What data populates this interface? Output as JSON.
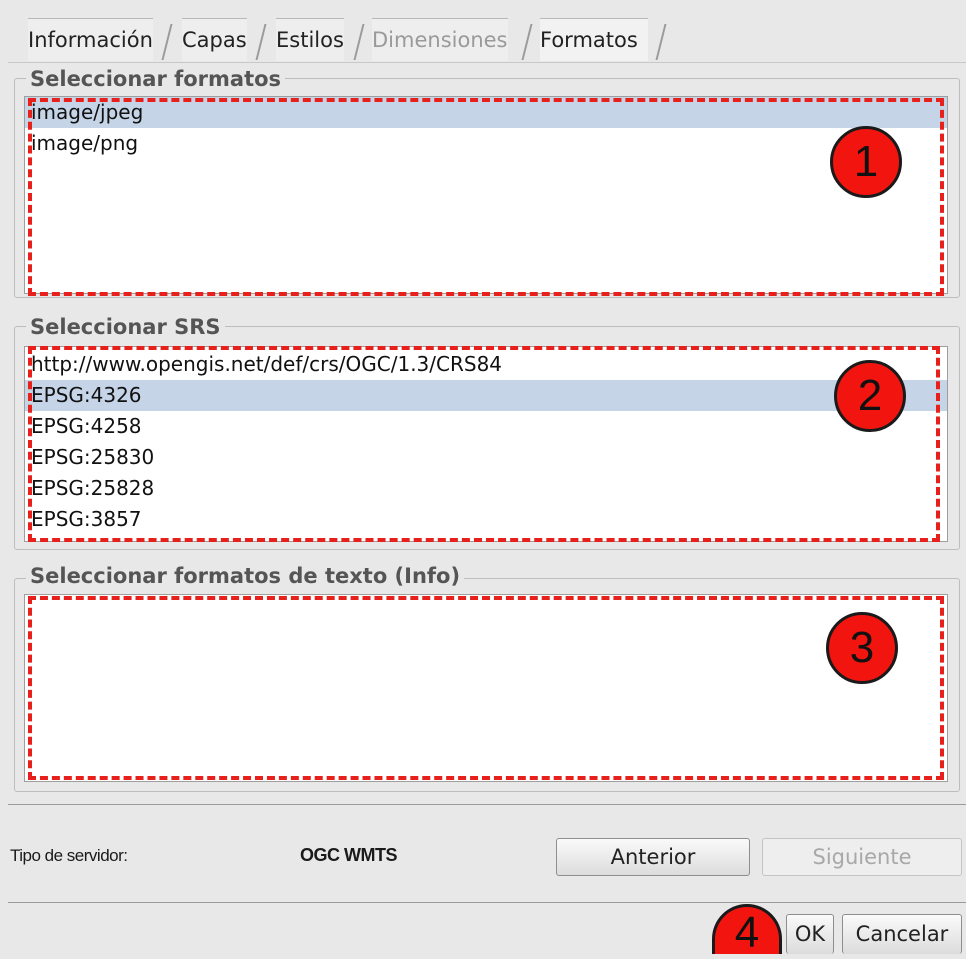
{
  "tabs": [
    {
      "label": "Información",
      "state": "normal"
    },
    {
      "label": "Capas",
      "state": "normal"
    },
    {
      "label": "Estilos",
      "state": "normal"
    },
    {
      "label": "Dimensiones",
      "state": "disabled"
    },
    {
      "label": "Formatos",
      "state": "active"
    }
  ],
  "formats_group": {
    "title": "Seleccionar formatos",
    "items": [
      "image/jpeg",
      "image/png"
    ],
    "selected": "image/jpeg"
  },
  "srs_group": {
    "title": "Seleccionar SRS",
    "items": [
      "http://www.opengis.net/def/crs/OGC/1.3/CRS84",
      "EPSG:4326",
      "EPSG:4258",
      "EPSG:25830",
      "EPSG:25828",
      "EPSG:3857"
    ],
    "selected": "EPSG:4326"
  },
  "info_formats_group": {
    "title": "Seleccionar formatos de texto (Info)",
    "items": []
  },
  "annotations": [
    "1",
    "2",
    "3",
    "4"
  ],
  "footer": {
    "server_type_label": "Tipo de servidor:",
    "server_type_value": "OGC WMTS",
    "prev_button": "Anterior",
    "next_button": "Siguiente",
    "ok_button": "OK",
    "cancel_button": "Cancelar"
  },
  "colors": {
    "highlight_red": "#e8201c",
    "selection_blue": "#c6d4e8"
  }
}
